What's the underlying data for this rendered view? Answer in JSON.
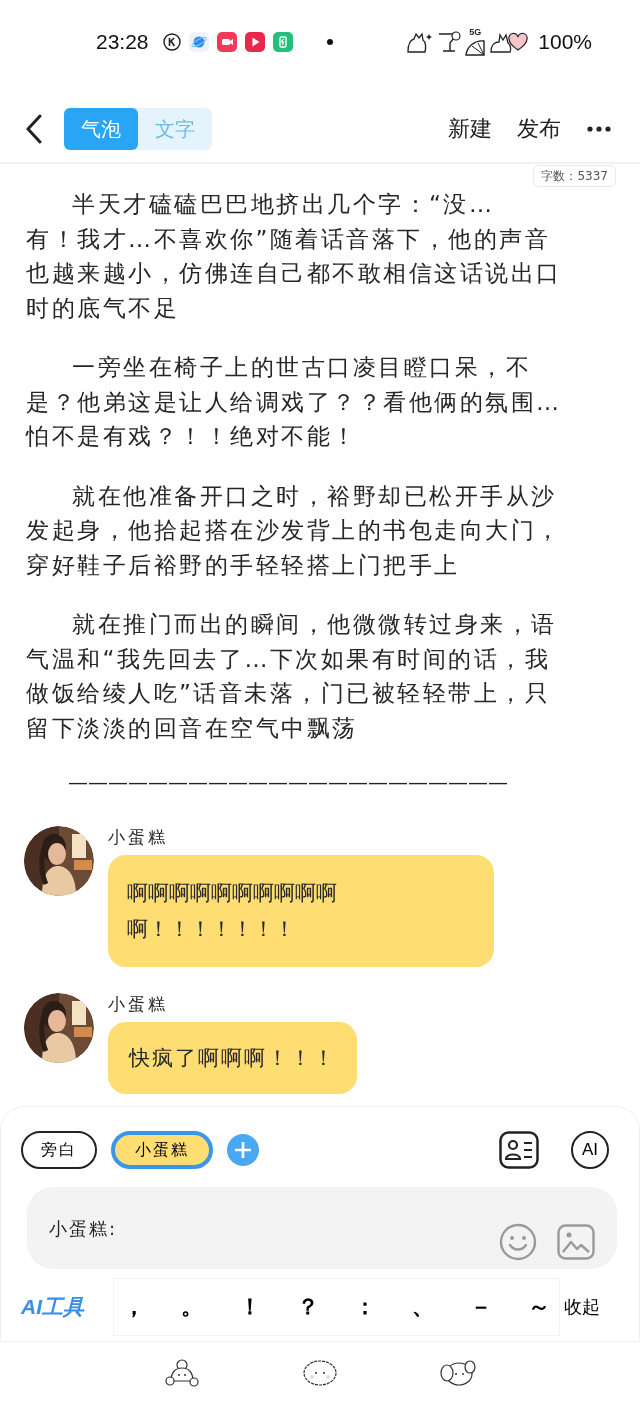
{
  "status_bar": {
    "time": "23:28",
    "signal_label": "5G",
    "battery": "100%"
  },
  "header": {
    "tabs": [
      {
        "label": "气泡",
        "selected": true
      },
      {
        "label": "文字",
        "selected": false
      }
    ],
    "actions": [
      "新建",
      "发布"
    ]
  },
  "word_count": "字数：5337",
  "paragraphs": [
    {
      "lines": [
        "半天才磕磕巴巴地挤出几个字：“没…",
        "有！我才…不喜欢你”随着话音落下，他的声音",
        "也越来越小，仿佛连自己都不敢相信这话说出口",
        "时的底气不足"
      ]
    },
    {
      "lines": [
        "一旁坐在椅子上的世古口凌目瞪口呆，不",
        "是？他弟这是让人给调戏了？？看他俩的氛围…",
        "怕不是有戏？！！绝对不能！"
      ]
    },
    {
      "lines": [
        "就在他准备开口之时，裕野却已松开手从沙",
        "发起身，他拾起搭在沙发背上的书包走向大门，",
        "穿好鞋子后裕野的手轻轻搭上门把手上"
      ]
    },
    {
      "lines": [
        "就在推门而出的瞬间，他微微转过身来，语",
        "气温和“我先回去了…下次如果有时间的话，我",
        "做饭给绫人吃”话音未落，门已被轻轻带上，只",
        "留下淡淡的回音在空气中飘荡"
      ]
    }
  ],
  "divider_text": "——————————————————————",
  "messages": [
    {
      "sender": "小蛋糕",
      "lines": [
        "啊啊啊啊啊啊啊啊啊啊",
        "啊！！！！！！！"
      ]
    },
    {
      "sender": "小蛋糕",
      "lines": [
        "快疯了啊啊啊！！！"
      ]
    }
  ],
  "composer": {
    "roles": [
      {
        "label": "旁白",
        "selected": false
      },
      {
        "label": "小蛋糕",
        "selected": true
      }
    ],
    "ai_label": "AI",
    "input_value": "小蛋糕:",
    "ai_tools": "AI工具",
    "punctuation": [
      "，",
      "。",
      "！",
      "？",
      "：",
      "、",
      "－",
      "～"
    ],
    "collapse": "收起"
  }
}
